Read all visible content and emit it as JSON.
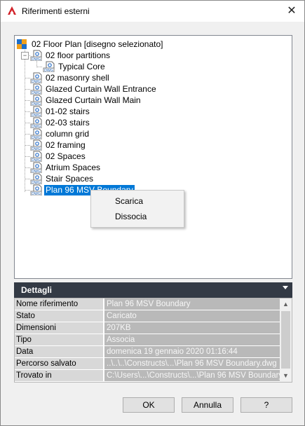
{
  "window": {
    "title": "Riferimenti esterni",
    "close_glyph": "✕",
    "app_icon": "autocad-logo-icon"
  },
  "tree": {
    "root": {
      "label": "02 Floor Plan [disegno selezionato]",
      "icon": "drawing-root-icon"
    },
    "items": [
      {
        "label": "02 floor partitions",
        "level": 1,
        "expanded": true,
        "icon": "dwg-file-icon"
      },
      {
        "label": "Typical Core",
        "level": 2,
        "icon": "dwg-file-icon"
      },
      {
        "label": "02 masonry shell",
        "level": 1,
        "icon": "dwg-file-icon"
      },
      {
        "label": "Glazed Curtain Wall Entrance",
        "level": 1,
        "icon": "dwg-file-icon"
      },
      {
        "label": "Glazed Curtain Wall Main",
        "level": 1,
        "icon": "dwg-file-icon"
      },
      {
        "label": "01-02 stairs",
        "level": 1,
        "icon": "dwg-file-icon"
      },
      {
        "label": "02-03 stairs",
        "level": 1,
        "icon": "dwg-file-icon"
      },
      {
        "label": "column grid",
        "level": 1,
        "icon": "dwg-file-icon"
      },
      {
        "label": "02 framing",
        "level": 1,
        "icon": "dwg-file-icon"
      },
      {
        "label": "02 Spaces",
        "level": 1,
        "icon": "dwg-file-icon"
      },
      {
        "label": "Atrium Spaces",
        "level": 1,
        "icon": "dwg-file-icon"
      },
      {
        "label": "Stair Spaces",
        "level": 1,
        "icon": "dwg-file-icon"
      },
      {
        "label": "Plan 96 MSV Boundary",
        "level": 1,
        "selected": true,
        "icon": "dwg-file-icon"
      }
    ],
    "expander_glyph": "−"
  },
  "context_menu": {
    "items": [
      "Scarica",
      "Dissocia"
    ]
  },
  "details": {
    "title": "Dettagli",
    "rows": [
      {
        "key": "Nome riferimento",
        "value": "Plan 96 MSV Boundary"
      },
      {
        "key": "Stato",
        "value": "Caricato"
      },
      {
        "key": "Dimensioni",
        "value": "207KB"
      },
      {
        "key": "Tipo",
        "value": "Associa"
      },
      {
        "key": "Data",
        "value": "domenica 19 gennaio 2020  01:16:44"
      },
      {
        "key": "Percorso salvato",
        "value": "..\\..\\..\\Constructs\\...\\Plan 96 MSV Boundary.dwg"
      },
      {
        "key": "Trovato in",
        "value": "C:\\Users\\...\\Constructs\\...\\Plan 96 MSV Boundary.dwg"
      }
    ],
    "scroll_up": "▲",
    "scroll_down": "▼"
  },
  "buttons": {
    "ok": "OK",
    "cancel": "Annulla",
    "help": "?"
  },
  "colors": {
    "selection": "#0078d7",
    "details_header": "#333a45",
    "autocad_red": "#d2232a"
  }
}
